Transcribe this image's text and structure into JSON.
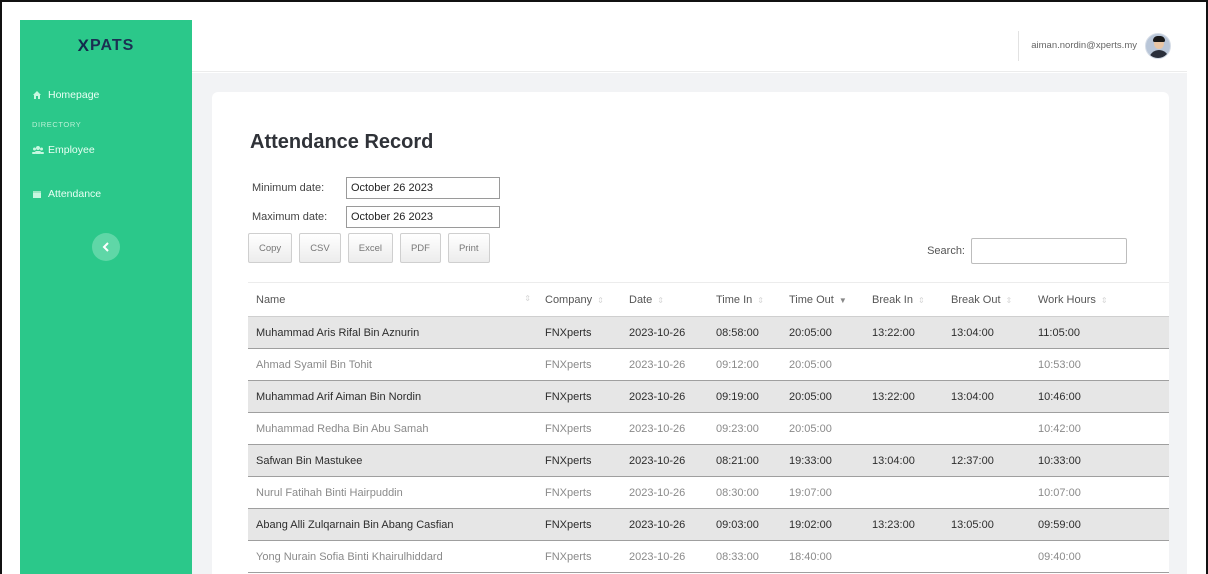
{
  "app": {
    "brand": "XPATS",
    "brand_mark": "X",
    "brand_rest": "PATS"
  },
  "sidebar": {
    "items": [
      {
        "label": "Homepage",
        "icon": "home-icon"
      },
      {
        "label": "Employee",
        "icon": "users-icon"
      },
      {
        "label": "Attendance",
        "icon": "calendar-icon"
      }
    ],
    "heading": "DIRECTORY",
    "collapse_icon": "chevron-left-icon"
  },
  "topbar": {
    "email": "aiman.nordin@xperts.my",
    "avatar": "user-avatar"
  },
  "page": {
    "title": "Attendance Record",
    "min_label": "Minimum date:",
    "min_value": "October 26 2023",
    "max_label": "Maximum date:",
    "max_value": "October 26 2023",
    "buttons": [
      "Copy",
      "CSV",
      "Excel",
      "PDF",
      "Print"
    ],
    "search_label": "Search:",
    "search_value": ""
  },
  "table": {
    "columns": [
      "Name",
      "Company",
      "Date",
      "Time In",
      "Time Out",
      "Break In",
      "Break Out",
      "Work Hours"
    ],
    "sorted_column": "Time Out",
    "rows": [
      [
        "Muhammad Aris Rifal Bin Aznurin",
        "FNXperts",
        "2023-10-26",
        "08:58:00",
        "20:05:00",
        "13:22:00",
        "13:04:00",
        "11:05:00"
      ],
      [
        "Ahmad Syamil Bin Tohit",
        "FNXperts",
        "2023-10-26",
        "09:12:00",
        "20:05:00",
        "",
        "",
        "10:53:00"
      ],
      [
        "Muhammad Arif Aiman Bin Nordin",
        "FNXperts",
        "2023-10-26",
        "09:19:00",
        "20:05:00",
        "13:22:00",
        "13:04:00",
        "10:46:00"
      ],
      [
        "Muhammad Redha Bin Abu Samah",
        "FNXperts",
        "2023-10-26",
        "09:23:00",
        "20:05:00",
        "",
        "",
        "10:42:00"
      ],
      [
        "Safwan Bin Mastukee",
        "FNXperts",
        "2023-10-26",
        "08:21:00",
        "19:33:00",
        "13:04:00",
        "12:37:00",
        "10:33:00"
      ],
      [
        "Nurul Fatihah Binti Hairpuddin",
        "FNXperts",
        "2023-10-26",
        "08:30:00",
        "19:07:00",
        "",
        "",
        "10:07:00"
      ],
      [
        "Abang Alli Zulqarnain Bin Abang Casfian",
        "FNXperts",
        "2023-10-26",
        "09:03:00",
        "19:02:00",
        "13:23:00",
        "13:05:00",
        "09:59:00"
      ],
      [
        "Yong Nurain Sofia Binti Khairulhiddard",
        "FNXperts",
        "2023-10-26",
        "08:33:00",
        "18:40:00",
        "",
        "",
        "09:40:00"
      ]
    ]
  },
  "colors": {
    "sidebar": "#2bc88a",
    "brand_text": "#1b2f52",
    "main_bg": "#f2f3f5"
  }
}
